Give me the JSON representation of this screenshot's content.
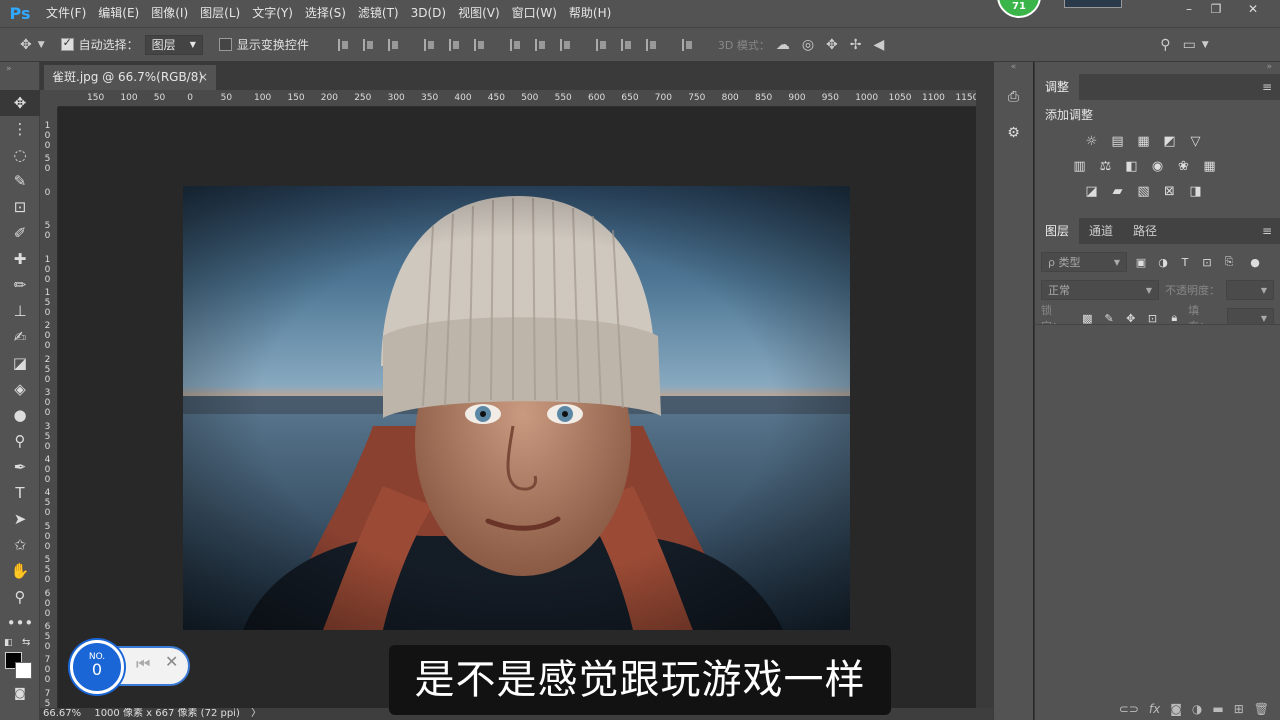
{
  "app": {
    "logo": "Ps"
  },
  "menu": [
    "文件(F)",
    "编辑(E)",
    "图像(I)",
    "图层(L)",
    "文字(Y)",
    "选择(S)",
    "滤镜(T)",
    "3D(D)",
    "视图(V)",
    "窗口(W)",
    "帮助(H)"
  ],
  "badge": {
    "value": "71"
  },
  "options": {
    "auto_select_label": "自动选择：",
    "auto_select_checked": true,
    "auto_select_target": "图层",
    "show_transform_label": "显示变换控件",
    "show_transform_checked": false,
    "mode_3d_label": "3D 模式："
  },
  "document": {
    "tab_title": "雀斑.jpg @ 66.7%(RGB/8)",
    "close_glyph": "×"
  },
  "ruler": {
    "h_labels": [
      "150",
      "100",
      "50",
      "0",
      "50",
      "100",
      "150",
      "200",
      "250",
      "300",
      "350",
      "400",
      "450",
      "500",
      "550",
      "600",
      "650",
      "700",
      "750",
      "800",
      "850",
      "900",
      "950",
      "1000",
      "1050",
      "1100",
      "1150"
    ],
    "v_labels": [
      "100",
      "50",
      "0",
      "50",
      "100",
      "150",
      "200",
      "250",
      "300",
      "350",
      "400",
      "450",
      "500",
      "550",
      "600",
      "650",
      "700",
      "750"
    ]
  },
  "status": {
    "zoom": "66.67%",
    "doc_size": "1000 像素 x 667 像素 (72 ppi)",
    "arrow": "〉"
  },
  "adjustments_panel": {
    "tab": "调整",
    "title": "添加调整"
  },
  "layers_panel": {
    "tabs": [
      "图层",
      "通道",
      "路径"
    ],
    "filter_placeholder": "ρ 类型",
    "blend_mode": "正常",
    "opacity_label": "不透明度：",
    "lock_label": "锁定：",
    "fill_label": "填充："
  },
  "counter": {
    "prefix": "NO.",
    "value": "0"
  },
  "subtitle": {
    "text": "是不是感觉跟玩游戏一样"
  },
  "colors": {
    "accent": "#31a8ff",
    "panel": "#535353",
    "canvas_bg": "#282828",
    "badge": "#3bb54a",
    "counter_blue": "#1a66d6"
  }
}
